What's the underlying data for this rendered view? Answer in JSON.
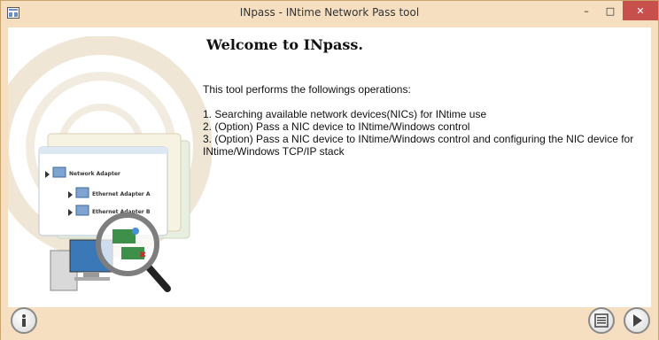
{
  "window": {
    "title": "INpass - INtime Network Pass tool",
    "minimize_label": "–",
    "maximize_label": "□",
    "close_label": "✕"
  },
  "main": {
    "heading": "Welcome to INpass.",
    "intro": "This tool performs the followings operations:",
    "operations": [
      "1. Searching available network devices(NICs) for INtime use",
      "2. (Option) Pass a NIC device to INtime/Windows control",
      "3. (Option) Pass a NIC device to INtime/Windows control and configuring the NIC device for INtime/Windows TCP/IP stack"
    ]
  },
  "illustration": {
    "tree_root": "Network Adapter",
    "tree_children": [
      "Ethernet Adapter A",
      "Ethernet Adapter B"
    ]
  },
  "footer": {
    "info_icon": "info-icon",
    "list_icon": "list-icon",
    "next_icon": "play-icon"
  },
  "colors": {
    "frame": "#f5dfc0",
    "close": "#c7504c"
  }
}
